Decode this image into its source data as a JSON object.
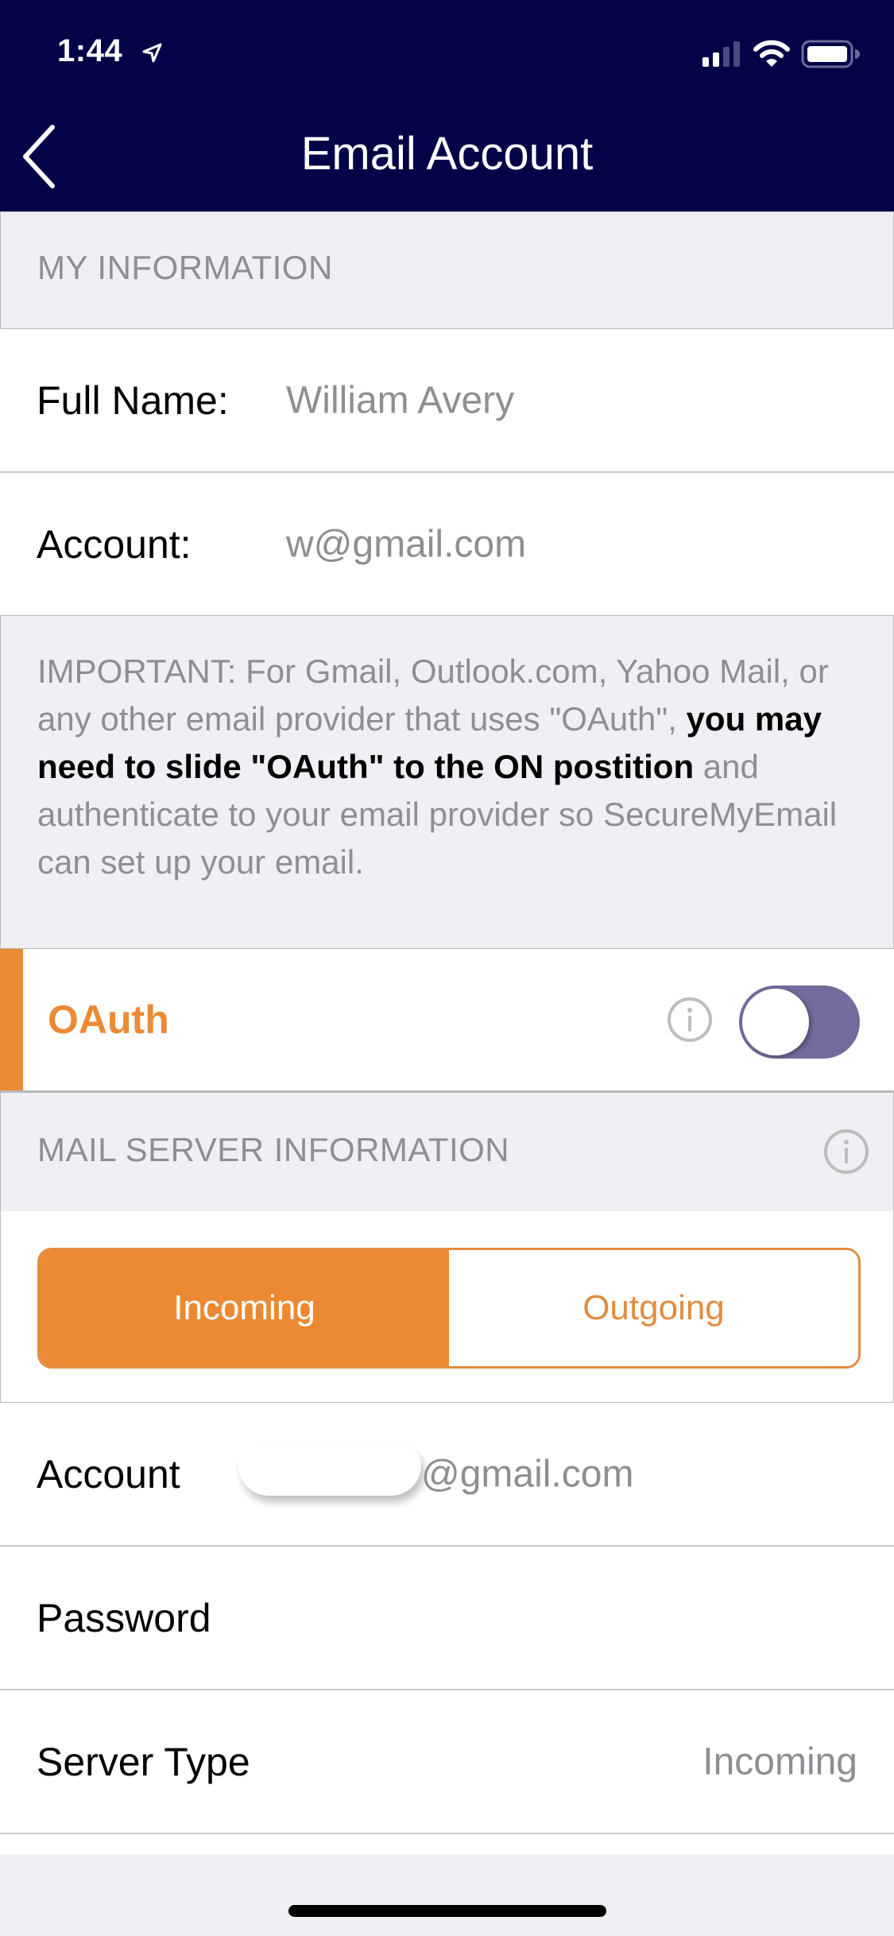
{
  "status_bar": {
    "time": "1:44",
    "location_icon": "location-arrow-icon",
    "signal_icon": "cellular-signal-icon",
    "signal_bars_active": 2,
    "signal_bars_total": 4,
    "wifi_icon": "wifi-icon",
    "battery_icon": "battery-icon"
  },
  "navbar": {
    "title": "Email Account",
    "back_icon": "chevron-left-icon",
    "background_color": "#020447"
  },
  "my_information": {
    "header": "MY INFORMATION",
    "full_name": {
      "label": "Full Name:",
      "value": "William Avery"
    },
    "account": {
      "label": "Account:",
      "value": "w@gmail.com"
    }
  },
  "notice": {
    "text_before": "IMPORTANT: For Gmail, Outlook.com, Yahoo Mail, or any other email provider that uses \"OAuth\",",
    "text_bold": "you may need to slide \"OAuth\" to the ON postition",
    "text_after": "and authenticate to your email provider so SecureMyEmail can set up your email."
  },
  "oauth": {
    "label": "OAuth",
    "info_icon": "info-circle-icon",
    "toggle_on": false,
    "accent_color": "#ec8a33",
    "toggle_color": "#736b9b"
  },
  "mail_server": {
    "header": "MAIL SERVER INFORMATION",
    "info_icon": "info-circle-icon",
    "segments": [
      {
        "label": "Incoming",
        "selected": true
      },
      {
        "label": "Outgoing",
        "selected": false
      }
    ],
    "account": {
      "label": "Account",
      "value_visible": "@gmail.com",
      "value_redacted": true
    },
    "password": {
      "label": "Password",
      "value": ""
    },
    "server_type": {
      "label": "Server Type",
      "value": "Incoming"
    }
  }
}
